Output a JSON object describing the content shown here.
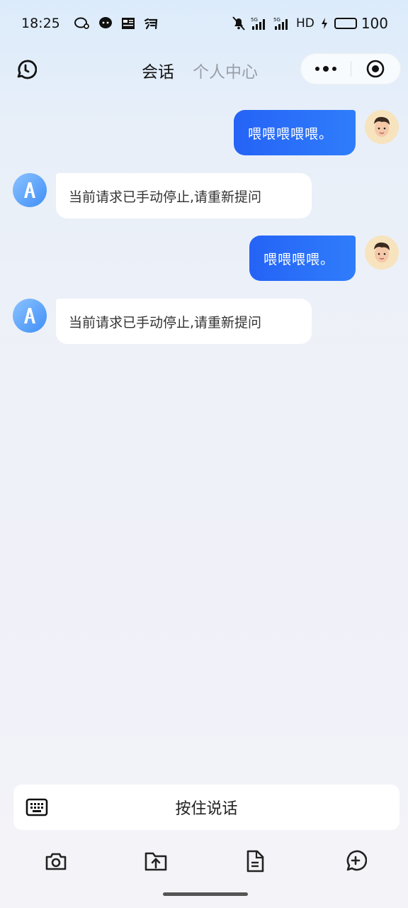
{
  "status_bar": {
    "time": "18:25",
    "network_1": "5G",
    "network_2": "5G",
    "hd_label": "HD",
    "battery_level": "100",
    "battery_fraction": 1.0,
    "left_icons": [
      "chat-bubble-icon",
      "message-icon",
      "news-icon",
      "taobao-icon"
    ]
  },
  "header": {
    "tabs": [
      {
        "label": "会话",
        "active": true
      },
      {
        "label": "个人中心",
        "active": false
      }
    ]
  },
  "messages": [
    {
      "role": "user",
      "text": "喂喂喂喂喂。"
    },
    {
      "role": "assistant",
      "text": "当前请求已手动停止,请重新提问"
    },
    {
      "role": "user",
      "text": "喂喂喂喂。"
    },
    {
      "role": "assistant",
      "text": "当前请求已手动停止,请重新提问"
    }
  ],
  "input": {
    "hold_to_talk": "按住说话"
  },
  "toolbar": {
    "icons": [
      "camera-icon",
      "folder-upload-icon",
      "document-icon",
      "chat-add-icon"
    ]
  },
  "colors": {
    "user_bubble": "#2563f6",
    "bot_bubble": "#ffffff",
    "tab_inactive": "#9a9ea6"
  }
}
